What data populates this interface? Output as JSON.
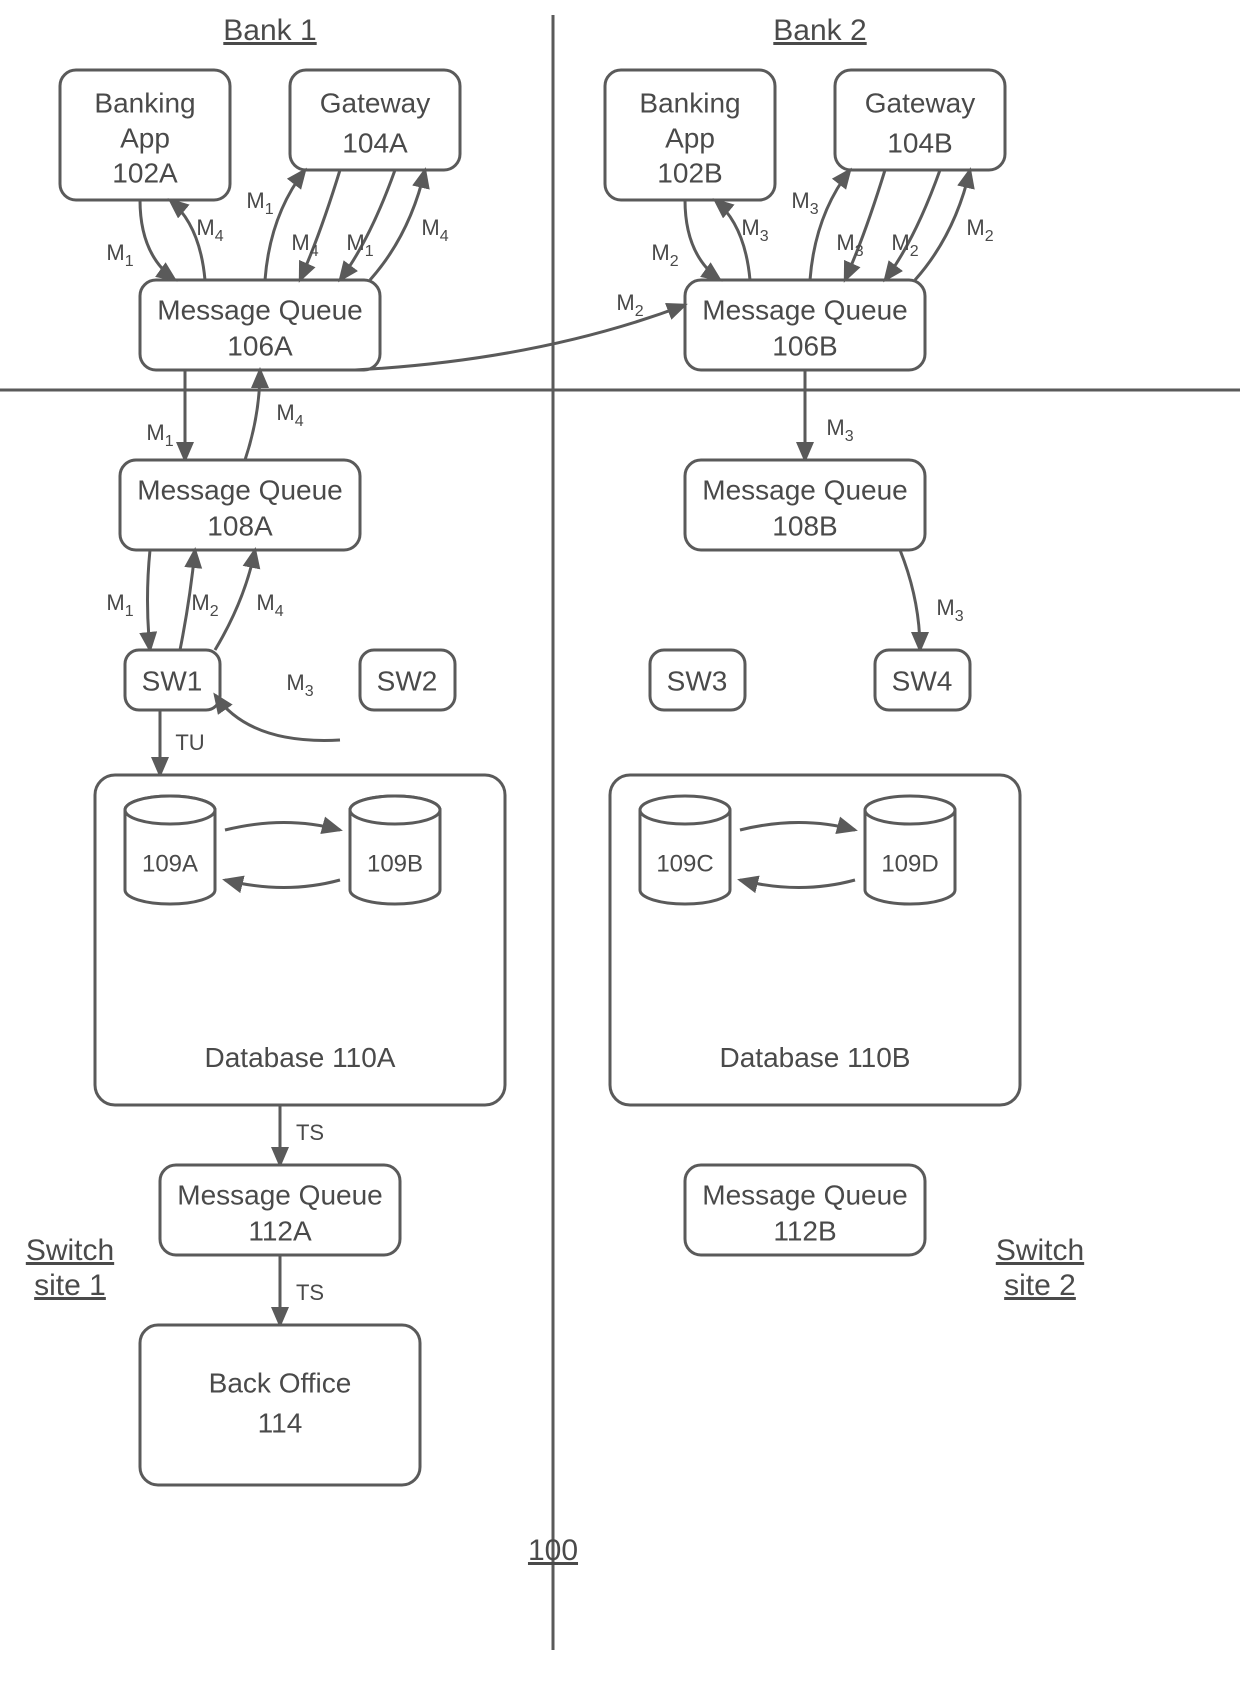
{
  "headers": {
    "bank1": "Bank 1",
    "bank2": "Bank 2"
  },
  "boxes": {
    "bankingAppA": {
      "l1": "Banking",
      "l2": "App",
      "l3": "102A"
    },
    "gatewayA": {
      "l1": "Gateway",
      "l2": "104A"
    },
    "bankingAppB": {
      "l1": "Banking",
      "l2": "App",
      "l3": "102B"
    },
    "gatewayB": {
      "l1": "Gateway",
      "l2": "104B"
    },
    "mq106A": {
      "l1": "Message Queue",
      "l2": "106A"
    },
    "mq106B": {
      "l1": "Message Queue",
      "l2": "106B"
    },
    "mq108A": {
      "l1": "Message Queue",
      "l2": "108A"
    },
    "mq108B": {
      "l1": "Message Queue",
      "l2": "108B"
    },
    "sw1": "SW1",
    "sw2": "SW2",
    "sw3": "SW3",
    "sw4": "SW4",
    "db110A": {
      "l1": "Database",
      "l2": "110A"
    },
    "db110B": {
      "l1": "Database",
      "l2": "110B"
    },
    "mq112A": {
      "l1": "Message Queue",
      "l2": "112A"
    },
    "mq112B": {
      "l1": "Message Queue",
      "l2": "112B"
    },
    "backOffice": {
      "l1": "Back Office",
      "l2": "114"
    }
  },
  "cyl": {
    "a": "109A",
    "b": "109B",
    "c": "109C",
    "d": "109D"
  },
  "sites": {
    "s1l1": "Switch",
    "s1l2": "site 1",
    "s2l1": "Switch",
    "s2l2": "site 2"
  },
  "figref": "100",
  "msgs": {
    "m1": "M",
    "m2": "M",
    "m3": "M",
    "m4": "M",
    "s1": "1",
    "s2": "2",
    "s3": "3",
    "s4": "4",
    "tu": "TU",
    "ts": "TS"
  }
}
